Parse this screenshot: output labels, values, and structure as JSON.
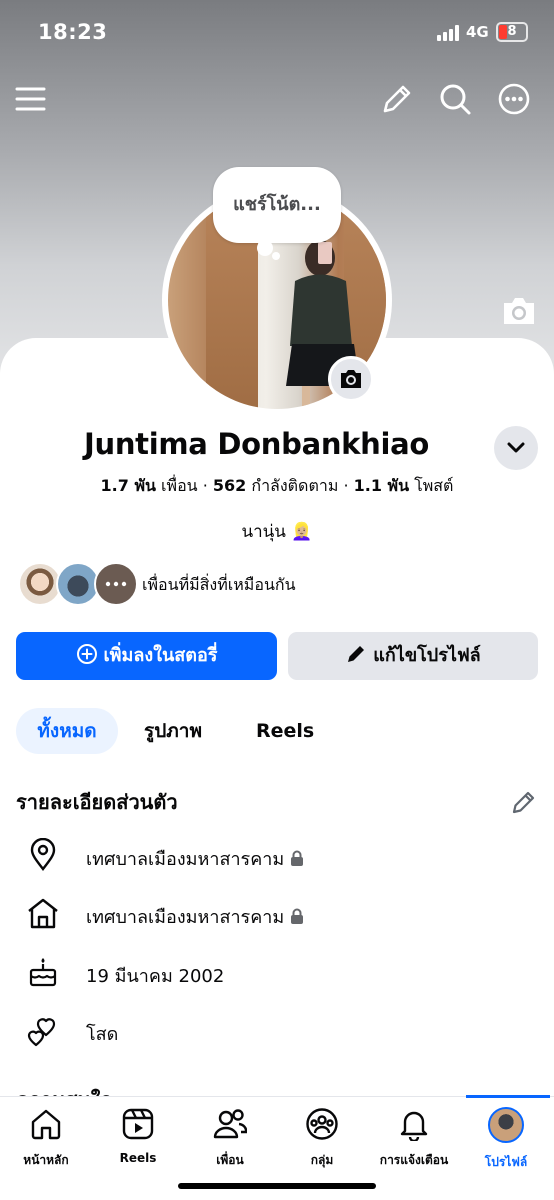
{
  "status_bar": {
    "time": "18:23",
    "network": "4G",
    "battery": "8"
  },
  "note": {
    "text": "แชร์โน้ต..."
  },
  "profile": {
    "name": "Juntima Donbankhiao",
    "stats": {
      "friends_count": "1.7 พัน",
      "friends_label": "เพื่อน",
      "following_count": "562",
      "following_label": "กำลังติดตาม",
      "posts_count": "1.1 พัน",
      "posts_label": "โพสต์"
    },
    "bio": "นานุ่น 👱🏼‍♀️",
    "mutual_text": "เพื่อนที่มีสิ่งที่เหมือนกัน"
  },
  "buttons": {
    "add_story": "เพิ่มลงในสตอรี่",
    "edit_profile": "แก้ไขโปรไฟล์"
  },
  "tabs": [
    {
      "label": "ทั้งหมด",
      "active": true
    },
    {
      "label": "รูปภาพ",
      "active": false
    },
    {
      "label": "Reels",
      "active": false
    }
  ],
  "details": {
    "title": "รายละเอียดส่วนตัว",
    "items": [
      {
        "icon": "location-pin-icon",
        "text": "เทศบาลเมืองมหาสารคาม",
        "locked": true
      },
      {
        "icon": "home-icon",
        "text": "เทศบาลเมืองมหาสารคาม",
        "locked": true
      },
      {
        "icon": "birthday-cake-icon",
        "text": "19 มีนาคม  2002",
        "locked": false
      },
      {
        "icon": "relationship-heart-icon",
        "text": "โสด",
        "locked": false
      }
    ]
  },
  "next_section_title": "ความสนใจ",
  "nav": [
    {
      "label": "หน้าหลัก",
      "icon": "home-icon"
    },
    {
      "label": "Reels",
      "icon": "reels-icon"
    },
    {
      "label": "เพื่อน",
      "icon": "friends-icon"
    },
    {
      "label": "กลุ่ม",
      "icon": "groups-icon"
    },
    {
      "label": "การแจ้งเตือน",
      "icon": "bell-icon"
    },
    {
      "label": "โปรไฟล์",
      "icon": "profile-avatar",
      "active": true
    }
  ],
  "colors": {
    "accent": "#0866ff",
    "secondary_button": "#e4e6eb",
    "active_tab_bg": "#ebf3ff",
    "battery_low": "#ff3b30"
  }
}
